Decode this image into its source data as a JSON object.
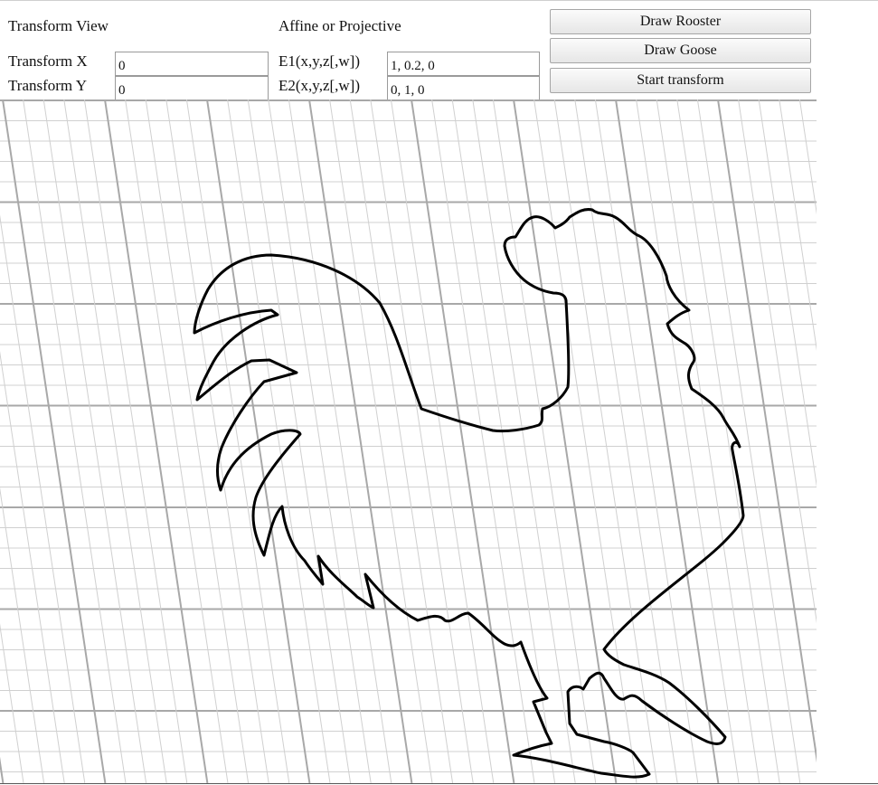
{
  "controls": {
    "transform_view_label": "Transform View",
    "affine_label": "Affine or Projective",
    "transform_x": {
      "label": "Transform X",
      "value": "0"
    },
    "transform_y": {
      "label": "Transform Y",
      "value": "0"
    },
    "e1": {
      "label": "E1(x,y,z[,w])",
      "value": "1, 0.2, 0"
    },
    "e2": {
      "label": "E2(x,y,z[,w])",
      "value": "0, 1, 0"
    }
  },
  "buttons": {
    "draw_rooster": "Draw Rooster",
    "draw_goose": "Draw Goose",
    "start_transform": "Start transform"
  },
  "canvas": {
    "drawing": "rooster",
    "grid_minor_color": "#d0d0d0",
    "grid_major_color": "#a8a8a8",
    "stroke_color": "#000000"
  }
}
